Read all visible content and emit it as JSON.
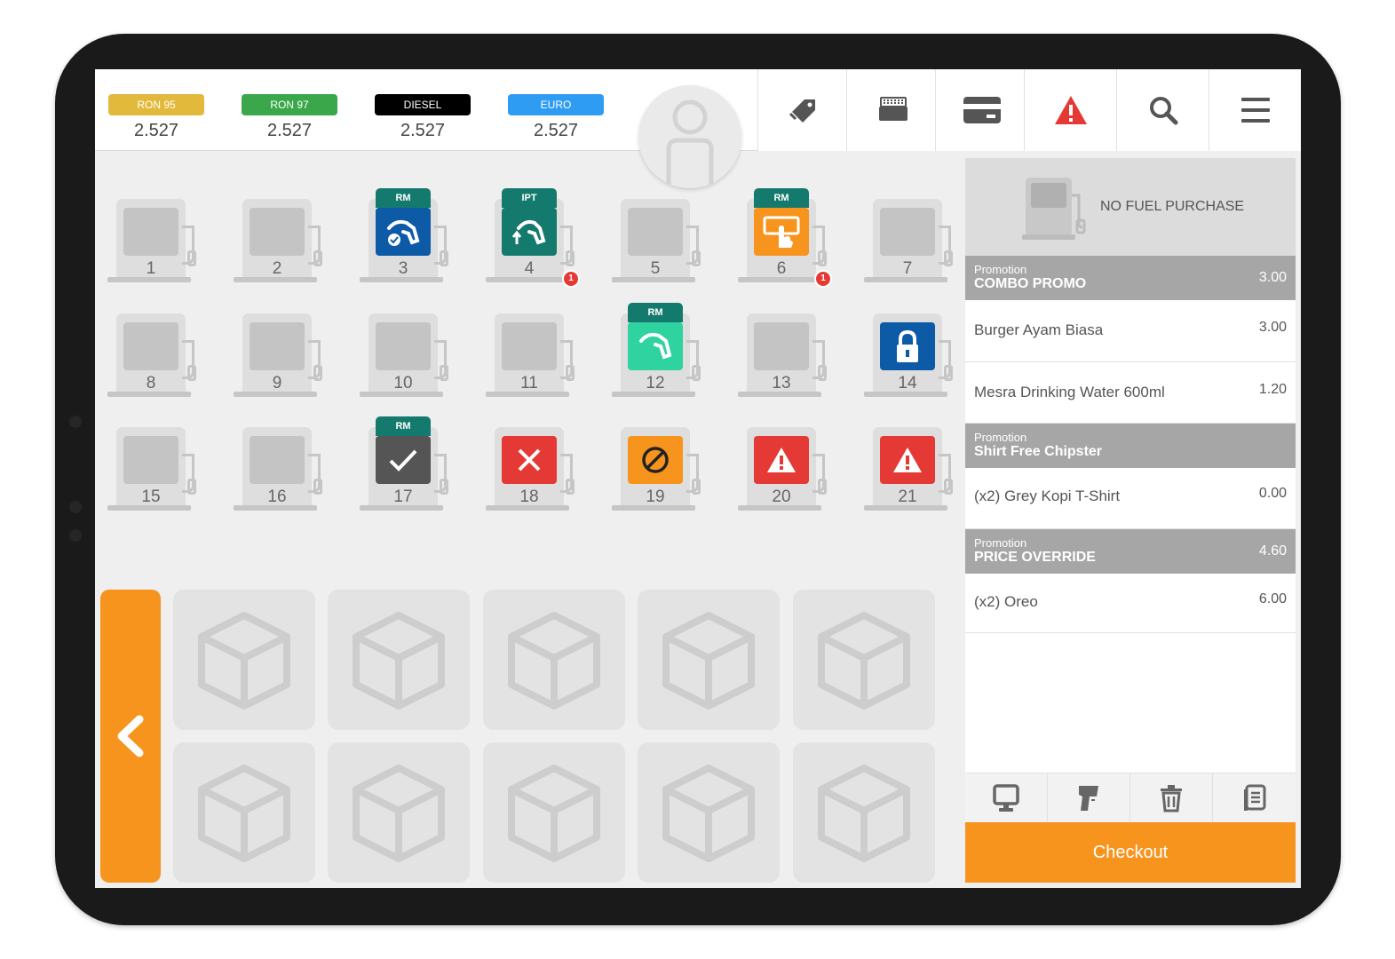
{
  "fuel_prices": [
    {
      "name": "RON 95",
      "price": "2.527",
      "color": "#e2b93b",
      "text_color": "#ffffff"
    },
    {
      "name": "RON 97",
      "price": "2.527",
      "color": "#3aa84a",
      "text_color": "#ffffff"
    },
    {
      "name": "DIESEL",
      "price": "2.527",
      "color": "#000000",
      "text_color": "#ffffff"
    },
    {
      "name": "EURO",
      "price": "2.527",
      "color": "#2f9cf4",
      "text_color": "#ffffff"
    }
  ],
  "toolbar": {
    "icons": [
      "tag-icon",
      "keyboard-icon",
      "card-icon",
      "alert-icon",
      "search-icon",
      "menu-icon"
    ],
    "alert_color": "#e53935",
    "icon_color": "#555555"
  },
  "pumps": [
    {
      "number": "1",
      "state": "idle"
    },
    {
      "number": "2",
      "state": "idle"
    },
    {
      "number": "3",
      "state": "pay",
      "badge": "RM",
      "color": "#0d5aa7"
    },
    {
      "number": "4",
      "state": "nozzle-up",
      "badge": "IPT",
      "color": "#157a6e",
      "notification": "1"
    },
    {
      "number": "5",
      "state": "idle"
    },
    {
      "number": "6",
      "state": "attention",
      "badge": "RM",
      "color": "#f7941d",
      "notification": "1"
    },
    {
      "number": "7",
      "state": "idle"
    },
    {
      "number": "8",
      "state": "idle"
    },
    {
      "number": "9",
      "state": "idle"
    },
    {
      "number": "10",
      "state": "idle"
    },
    {
      "number": "11",
      "state": "idle"
    },
    {
      "number": "12",
      "state": "fueling",
      "badge": "RM",
      "color": "#2ed3a0"
    },
    {
      "number": "13",
      "state": "idle"
    },
    {
      "number": "14",
      "state": "locked",
      "color": "#0d5aa7"
    },
    {
      "number": "15",
      "state": "idle"
    },
    {
      "number": "16",
      "state": "idle"
    },
    {
      "number": "17",
      "state": "done",
      "badge": "RM",
      "color": "#555555"
    },
    {
      "number": "18",
      "state": "error",
      "color": "#e53935"
    },
    {
      "number": "19",
      "state": "blocked",
      "color": "#f7941d"
    },
    {
      "number": "20",
      "state": "warning",
      "color": "#e53935"
    },
    {
      "number": "21",
      "state": "warning",
      "color": "#e53935"
    }
  ],
  "cart": {
    "no_fuel_label": "NO FUEL PURCHASE",
    "promotions": [
      {
        "title": "Promotion",
        "name": "COMBO PROMO",
        "amount": "3.00"
      },
      {
        "title": "Promotion",
        "name": "Shirt Free Chipster",
        "amount": ""
      },
      {
        "title": "Promotion",
        "name": "PRICE OVERRIDE",
        "amount": "4.60"
      }
    ],
    "items": [
      {
        "name": "Burger Ayam Biasa",
        "amount": "3.00"
      },
      {
        "name": "Mesra Drinking Water 600ml",
        "amount": "1.20"
      },
      {
        "name": "(x2)  Grey Kopi T-Shirt",
        "amount": "0.00"
      },
      {
        "name": "(x2)  Oreo",
        "amount": "6.00"
      }
    ],
    "tools": [
      "display-icon",
      "scanner-icon",
      "trash-icon",
      "receipt-icon"
    ],
    "checkout_label": "Checkout"
  },
  "theme": {
    "accent": "#f7941d",
    "promo_bg": "#a6a6a6"
  }
}
